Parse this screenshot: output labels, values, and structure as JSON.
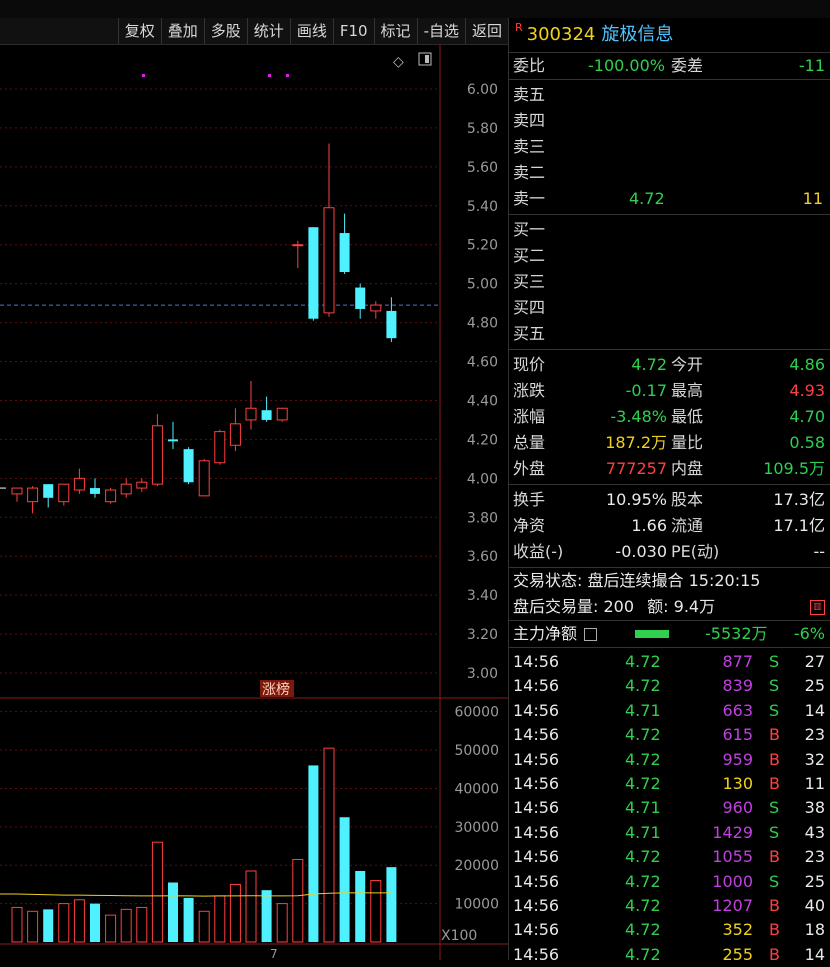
{
  "toolbar": [
    "复权",
    "叠加",
    "多股",
    "统计",
    "画线",
    "F10",
    "标记",
    "-自选",
    "返回"
  ],
  "stock": {
    "flag": "R",
    "code": "300324",
    "name": "旋极信息"
  },
  "colors": {
    "up": "#ff4040",
    "down": "#2ed04e",
    "bg": "#000000",
    "cyan": "#4ff0ff",
    "magenta": "#e020e0"
  },
  "weibi": {
    "label": "委比",
    "value": "-100.00%",
    "label2": "委差",
    "value2": "-11"
  },
  "asks": [
    {
      "label": "卖五",
      "price": "",
      "qty": ""
    },
    {
      "label": "卖四",
      "price": "",
      "qty": ""
    },
    {
      "label": "卖三",
      "price": "",
      "qty": ""
    },
    {
      "label": "卖二",
      "price": "",
      "qty": ""
    },
    {
      "label": "卖一",
      "price": "4.72",
      "qty": "11"
    }
  ],
  "bids": [
    {
      "label": "买一"
    },
    {
      "label": "买二"
    },
    {
      "label": "买三"
    },
    {
      "label": "买四"
    },
    {
      "label": "买五"
    }
  ],
  "quote": [
    {
      "l1": "现价",
      "v1": "4.72",
      "c1": "g",
      "l2": "今开",
      "v2": "4.86",
      "c2": "g"
    },
    {
      "l1": "涨跌",
      "v1": "-0.17",
      "c1": "g",
      "l2": "最高",
      "v2": "4.93",
      "c2": "r2"
    },
    {
      "l1": "涨幅",
      "v1": "-3.48%",
      "c1": "g",
      "l2": "最低",
      "v2": "4.70",
      "c2": "g"
    },
    {
      "l1": "总量",
      "v1": "187.2万",
      "c1": "y",
      "l2": "量比",
      "v2": "0.58",
      "c2": "g"
    },
    {
      "l1": "外盘",
      "v1": "777257",
      "c1": "r2",
      "l2": "内盘",
      "v2": "109.5万",
      "c2": "g"
    }
  ],
  "stats": [
    {
      "l1": "换手",
      "v1": "10.95%",
      "l2": "股本",
      "v2": "17.3亿"
    },
    {
      "l1": "净资",
      "v1": "1.66",
      "l2": "流通",
      "v2": "17.1亿"
    },
    {
      "l1": "收益(-)",
      "v1": "-0.030",
      "l2": "PE(动)",
      "v2": "--"
    }
  ],
  "status": {
    "label": "交易状态:",
    "value": "盘后连续撮合 15:20:15"
  },
  "after": {
    "label": "盘后交易量:",
    "vol": "200",
    "label2": "额:",
    "amt": "9.4万"
  },
  "mainflow": {
    "label": "主力净额",
    "value": "-5532万",
    "pct": "-6%"
  },
  "ticks": [
    {
      "t": "14:56",
      "p": "4.72",
      "v": "877",
      "c": "m",
      "bs": "S",
      "n": "27"
    },
    {
      "t": "14:56",
      "p": "4.72",
      "v": "839",
      "c": "m",
      "bs": "S",
      "n": "25"
    },
    {
      "t": "14:56",
      "p": "4.71",
      "v": "663",
      "c": "m",
      "bs": "S",
      "n": "14"
    },
    {
      "t": "14:56",
      "p": "4.72",
      "v": "615",
      "c": "m",
      "bs": "B",
      "n": "23"
    },
    {
      "t": "14:56",
      "p": "4.72",
      "v": "959",
      "c": "m",
      "bs": "B",
      "n": "32"
    },
    {
      "t": "14:56",
      "p": "4.72",
      "v": "130",
      "c": "y",
      "bs": "B",
      "n": "11"
    },
    {
      "t": "14:56",
      "p": "4.71",
      "v": "960",
      "c": "m",
      "bs": "S",
      "n": "38"
    },
    {
      "t": "14:56",
      "p": "4.71",
      "v": "1429",
      "c": "m",
      "bs": "S",
      "n": "43"
    },
    {
      "t": "14:56",
      "p": "4.72",
      "v": "1055",
      "c": "m",
      "bs": "B",
      "n": "23"
    },
    {
      "t": "14:56",
      "p": "4.72",
      "v": "1000",
      "c": "m",
      "bs": "S",
      "n": "25"
    },
    {
      "t": "14:56",
      "p": "4.72",
      "v": "1207",
      "c": "m",
      "bs": "B",
      "n": "40"
    },
    {
      "t": "14:56",
      "p": "4.72",
      "v": "352",
      "c": "y",
      "bs": "B",
      "n": "18"
    },
    {
      "t": "14:56",
      "p": "4.72",
      "v": "255",
      "c": "y",
      "bs": "B",
      "n": "14"
    }
  ],
  "chart_data": {
    "type": "candlestick",
    "price_ticks": [
      "6.00",
      "5.80",
      "5.60",
      "5.40",
      "5.20",
      "5.00",
      "4.80",
      "4.60",
      "4.40",
      "4.20",
      "4.00",
      "3.80",
      "3.60",
      "3.40",
      "3.20",
      "3.00"
    ],
    "price_range": [
      3.0,
      6.0
    ],
    "ref_price": 4.89,
    "vol_ticks": [
      "60000",
      "50000",
      "40000",
      "30000",
      "20000",
      "10000"
    ],
    "vol_unit": "X100",
    "vol_range": [
      0,
      62000
    ],
    "tag": "涨榜",
    "xlabel_mark": "7",
    "candles": [
      {
        "o": 3.92,
        "h": 3.95,
        "l": 3.88,
        "c": 3.95,
        "v": 9000
      },
      {
        "o": 3.88,
        "h": 3.96,
        "l": 3.82,
        "c": 3.95,
        "v": 8000
      },
      {
        "o": 3.97,
        "h": 3.97,
        "l": 3.85,
        "c": 3.9,
        "v": 8500
      },
      {
        "o": 3.88,
        "h": 3.97,
        "l": 3.86,
        "c": 3.97,
        "v": 10000
      },
      {
        "o": 3.94,
        "h": 4.05,
        "l": 3.92,
        "c": 4.0,
        "v": 11000
      },
      {
        "o": 3.95,
        "h": 4.0,
        "l": 3.9,
        "c": 3.92,
        "v": 10000
      },
      {
        "o": 3.88,
        "h": 3.95,
        "l": 3.87,
        "c": 3.94,
        "v": 7000
      },
      {
        "o": 3.92,
        "h": 4.0,
        "l": 3.9,
        "c": 3.97,
        "v": 8500
      },
      {
        "o": 3.95,
        "h": 4.0,
        "l": 3.93,
        "c": 3.98,
        "v": 9000
      },
      {
        "o": 3.97,
        "h": 4.33,
        "l": 3.96,
        "c": 4.27,
        "v": 26000
      },
      {
        "o": 4.2,
        "h": 4.29,
        "l": 4.15,
        "c": 4.19,
        "v": 15500
      },
      {
        "o": 4.15,
        "h": 4.16,
        "l": 3.97,
        "c": 3.98,
        "v": 11500
      },
      {
        "o": 3.91,
        "h": 4.1,
        "l": 3.91,
        "c": 4.09,
        "v": 8000
      },
      {
        "o": 4.08,
        "h": 4.25,
        "l": 4.07,
        "c": 4.24,
        "v": 12000
      },
      {
        "o": 4.17,
        "h": 4.36,
        "l": 4.14,
        "c": 4.28,
        "v": 15000
      },
      {
        "o": 4.3,
        "h": 4.5,
        "l": 4.25,
        "c": 4.36,
        "v": 18500
      },
      {
        "o": 4.35,
        "h": 4.42,
        "l": 4.29,
        "c": 4.3,
        "v": 13500
      },
      {
        "o": 4.3,
        "h": 4.36,
        "l": 4.29,
        "c": 4.36,
        "v": 10000
      },
      {
        "o": 5.2,
        "h": 5.22,
        "l": 5.08,
        "c": 5.2,
        "v": 21500
      },
      {
        "o": 5.29,
        "h": 5.29,
        "l": 4.81,
        "c": 4.82,
        "v": 46000
      },
      {
        "o": 4.85,
        "h": 5.72,
        "l": 4.83,
        "c": 5.39,
        "v": 50500
      },
      {
        "o": 5.26,
        "h": 5.36,
        "l": 5.05,
        "c": 5.06,
        "v": 32500
      },
      {
        "o": 4.98,
        "h": 5.0,
        "l": 4.82,
        "c": 4.87,
        "v": 18500
      },
      {
        "o": 4.86,
        "h": 4.91,
        "l": 4.82,
        "c": 4.89,
        "v": 16000
      },
      {
        "o": 4.86,
        "h": 4.93,
        "l": 4.7,
        "c": 4.72,
        "v": 19500
      }
    ],
    "vol_ma": [
      12500,
      12400,
      12300,
      12200,
      12200,
      12150,
      12100,
      12050,
      12000,
      12000,
      12050,
      12000,
      11950,
      12000,
      12000,
      12050,
      12000,
      12000,
      12050,
      12500,
      12700,
      12800,
      12800,
      12800,
      12800
    ]
  }
}
